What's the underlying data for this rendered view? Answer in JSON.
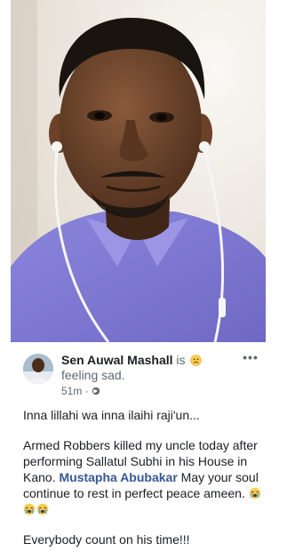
{
  "post": {
    "author_name": "Sen Auwal Mashall",
    "is_text": "is",
    "feeling_emoji": "sad-face-emoji",
    "feeling_text": "feeling sad.",
    "timestamp": "51m",
    "separator": "·",
    "privacy_icon": "globe-icon",
    "more_label": "•••",
    "paragraph_1": "Inna lillahi wa inna ilaihi raji'un...",
    "paragraph_2_before_mention": "Armed Robbers killed my uncle today after performing Sallatul Subhi in his House in Kano.",
    "mention": "Mustapha Abubakar",
    "paragraph_2_after_mention": "May your soul continue to rest in perfect peace ameen.",
    "crying_emojis": [
      "crying-face-emoji",
      "crying-face-emoji",
      "crying-face-emoji"
    ],
    "paragraph_3": "Everybody count on his time!!!"
  },
  "colors": {
    "text": "#1c1e21",
    "secondary_text": "#606770",
    "mention_link": "#385898",
    "shirt": "#7f7ad0"
  }
}
